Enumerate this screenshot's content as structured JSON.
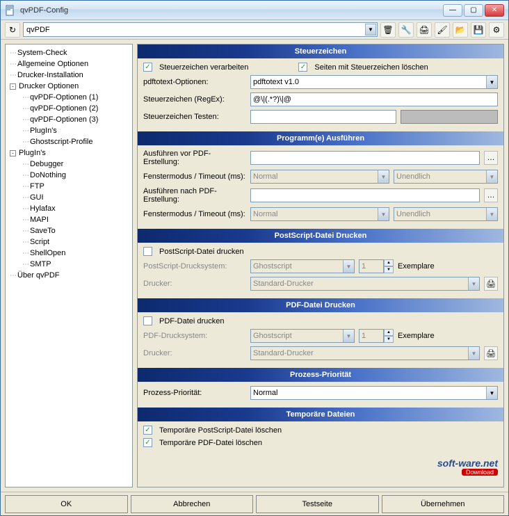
{
  "window": {
    "title": "qvPDF-Config"
  },
  "toolbar": {
    "profile": "qvPDF"
  },
  "tree": {
    "items": [
      {
        "label": "System-Check",
        "depth": 1
      },
      {
        "label": "Allgemeine Optionen",
        "depth": 1
      },
      {
        "label": "Drucker-Installation",
        "depth": 1
      },
      {
        "label": "Drucker Optionen",
        "depth": 1,
        "exp": "-"
      },
      {
        "label": "qvPDF-Optionen (1)",
        "depth": 2
      },
      {
        "label": "qvPDF-Optionen (2)",
        "depth": 2
      },
      {
        "label": "qvPDF-Optionen (3)",
        "depth": 2
      },
      {
        "label": "PlugIn's",
        "depth": 2
      },
      {
        "label": "Ghostscript-Profile",
        "depth": 2
      },
      {
        "label": "PlugIn's",
        "depth": 1,
        "exp": "-"
      },
      {
        "label": "Debugger",
        "depth": 2
      },
      {
        "label": "DoNothing",
        "depth": 2
      },
      {
        "label": "FTP",
        "depth": 2
      },
      {
        "label": "GUI",
        "depth": 2
      },
      {
        "label": "Hylafax",
        "depth": 2
      },
      {
        "label": "MAPI",
        "depth": 2
      },
      {
        "label": "SaveTo",
        "depth": 2
      },
      {
        "label": "Script",
        "depth": 2
      },
      {
        "label": "ShellOpen",
        "depth": 2
      },
      {
        "label": "SMTP",
        "depth": 2
      },
      {
        "label": "Über qvPDF",
        "depth": 1
      }
    ]
  },
  "sections": {
    "steuerzeichen": {
      "title": "Steuerzeichen",
      "chk1_label": "Steuerzeichen verarbeiten",
      "chk2_label": "Seiten mit Steuerzeichen löschen",
      "opt_label": "pdftotext-Optionen:",
      "opt_value": "pdftotext v1.0",
      "regex_label": "Steuerzeichen (RegEx):",
      "regex_value": "@\\|(.*?)\\|@",
      "test_label": "Steuerzeichen Testen:"
    },
    "programme": {
      "title": "Programm(e) Ausführen",
      "before_label": "Ausführen vor PDF-Erstellung:",
      "mode_label": "Fenstermodus / Timeout (ms):",
      "after_label": "Ausführen nach PDF-Erstellung:",
      "mode_value": "Normal",
      "timeout_value": "Unendlich"
    },
    "ps_print": {
      "title": "PostScript-Datei Drucken",
      "chk_label": "PostScript-Datei drucken",
      "system_label": "PostScript-Drucksystem:",
      "system_value": "Ghostscript",
      "copies_value": "1",
      "copies_label": "Exemplare",
      "printer_label": "Drucker:",
      "printer_value": "Standard-Drucker"
    },
    "pdf_print": {
      "title": "PDF-Datei Drucken",
      "chk_label": "PDF-Datei drucken",
      "system_label": "PDF-Drucksystem:",
      "system_value": "Ghostscript",
      "copies_value": "1",
      "copies_label": "Exemplare",
      "printer_label": "Drucker:",
      "printer_value": "Standard-Drucker"
    },
    "priority": {
      "title": "Prozess-Priorität",
      "label": "Prozess-Priorität:",
      "value": "Normal"
    },
    "temp": {
      "title": "Temporäre Dateien",
      "chk1_label": "Temporäre PostScript-Datei löschen",
      "chk2_label": "Temporäre PDF-Datei löschen"
    }
  },
  "watermark": {
    "logo": "soft-ware.net",
    "download": "Download"
  },
  "footer": {
    "ok": "OK",
    "cancel": "Abbrechen",
    "test": "Testseite",
    "apply": "Übernehmen"
  }
}
